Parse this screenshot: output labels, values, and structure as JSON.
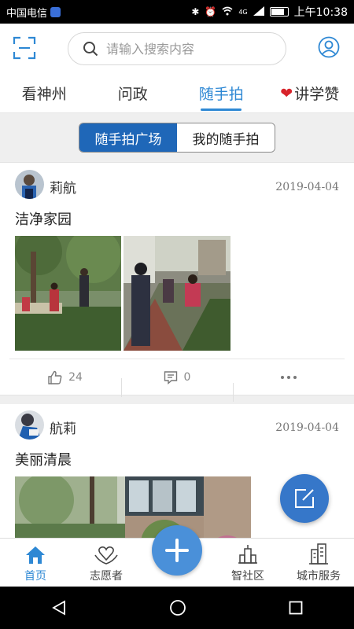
{
  "status_bar": {
    "carrier": "中国电信",
    "network": "4G",
    "time": "上午10:38"
  },
  "search": {
    "placeholder": "请输入搜索内容"
  },
  "tabs": [
    {
      "label": "看神州",
      "active": false
    },
    {
      "label": "问政",
      "active": false
    },
    {
      "label": "随手拍",
      "active": true
    },
    {
      "label": "讲学赞",
      "active": false,
      "icon": "heart-icon"
    }
  ],
  "segment": {
    "options": [
      {
        "label": "随手拍广场",
        "active": true
      },
      {
        "label": "我的随手拍",
        "active": false
      }
    ]
  },
  "posts": [
    {
      "author": "莉航",
      "date": "2019-04-04",
      "title": "洁净家园",
      "likes": "24",
      "comments": "0"
    },
    {
      "author": "航莉",
      "date": "2019-04-04",
      "title": "美丽清晨"
    }
  ],
  "bottom_nav": [
    {
      "label": "首页",
      "icon": "home-icon",
      "active": true
    },
    {
      "label": "志愿者",
      "icon": "volunteer-heart-icon",
      "active": false
    },
    {
      "label": "",
      "icon": "add-icon",
      "active": false
    },
    {
      "label": "智社区",
      "icon": "community-building-icon",
      "active": false
    },
    {
      "label": "城市服务",
      "icon": "city-buildings-icon",
      "active": false
    }
  ],
  "colors": {
    "accent": "#2e88d4",
    "segment_active": "#1f67b8",
    "fab": "#3677c9",
    "heart": "#d8232a"
  }
}
